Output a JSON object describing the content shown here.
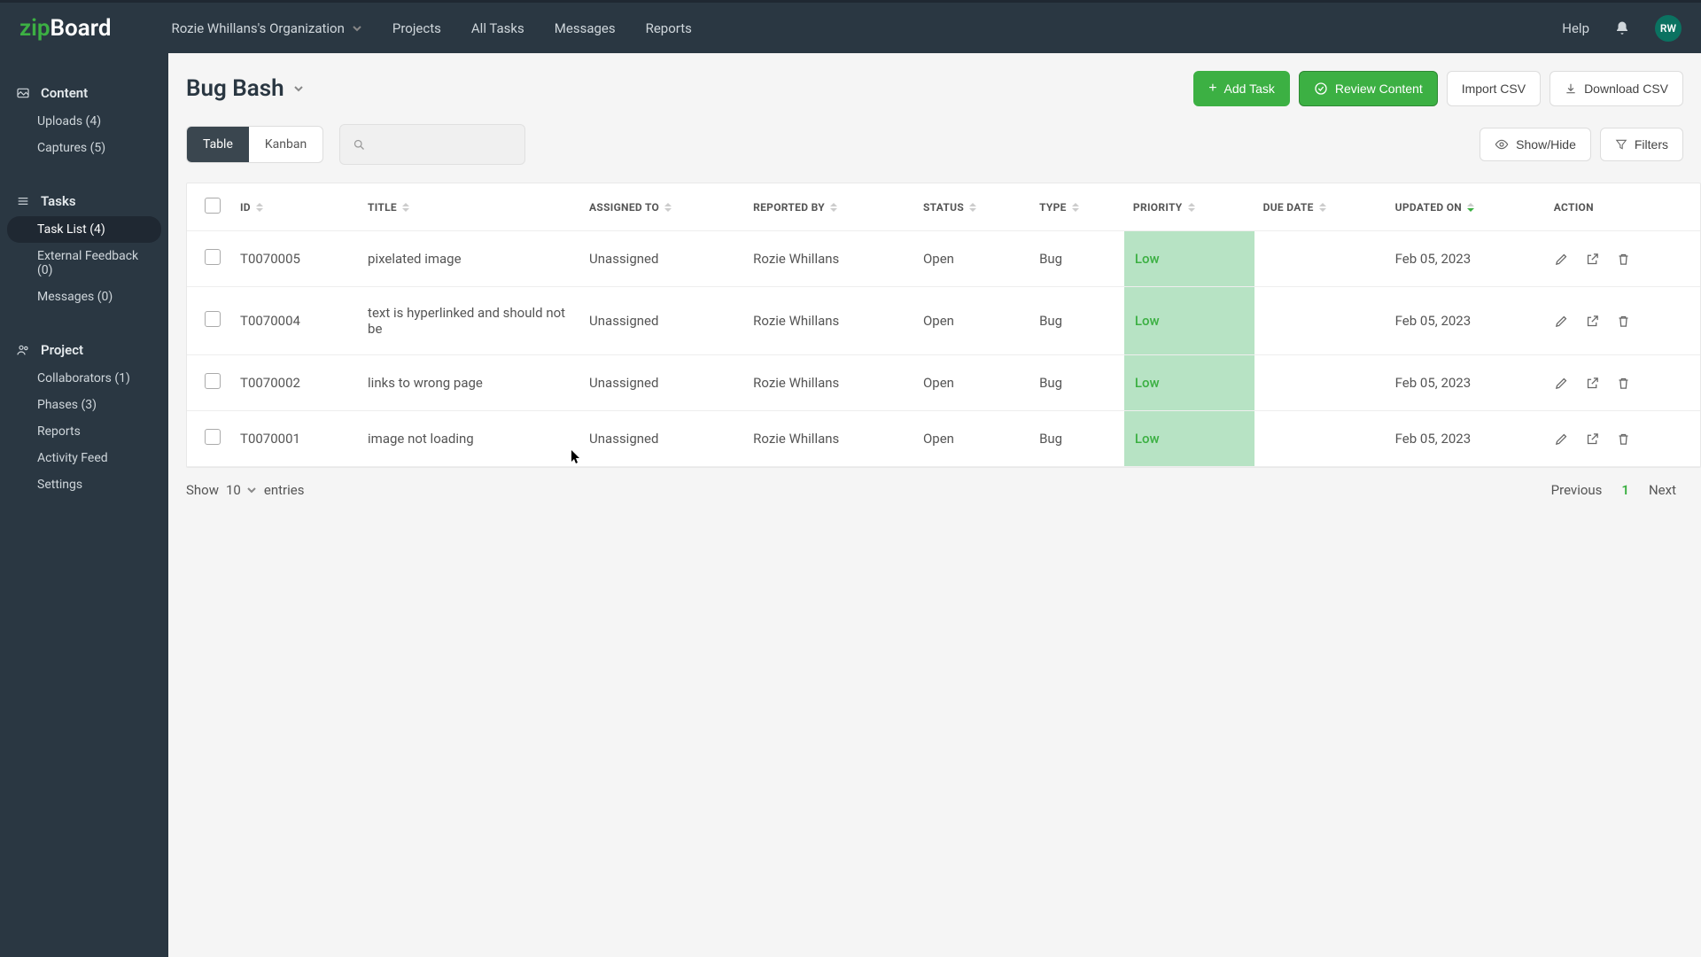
{
  "brand": {
    "zip": "zip",
    "board": "Board"
  },
  "topnav": {
    "org": "Rozie Whillans's Organization",
    "items": [
      "Projects",
      "All Tasks",
      "Messages",
      "Reports"
    ],
    "help": "Help",
    "avatar": "RW"
  },
  "sidebar": {
    "content": {
      "heading": "Content",
      "items": [
        "Uploads (4)",
        "Captures (5)"
      ]
    },
    "tasks": {
      "heading": "Tasks",
      "items": [
        "Task List (4)",
        "External Feedback (0)",
        "Messages (0)"
      ],
      "active_index": 0
    },
    "project": {
      "heading": "Project",
      "items": [
        "Collaborators (1)",
        "Phases (3)",
        "Reports",
        "Activity Feed",
        "Settings"
      ]
    }
  },
  "page": {
    "title": "Bug Bash",
    "buttons": {
      "add": "Add Task",
      "review": "Review Content",
      "import": "Import CSV",
      "download": "Download CSV"
    },
    "views": {
      "table": "Table",
      "kanban": "Kanban"
    },
    "tools": {
      "showhide": "Show/Hide",
      "filters": "Filters"
    }
  },
  "table": {
    "headers": [
      "ID",
      "TITLE",
      "ASSIGNED TO",
      "REPORTED BY",
      "STATUS",
      "TYPE",
      "PRIORITY",
      "DUE DATE",
      "UPDATED ON",
      "ACTION"
    ],
    "rows": [
      {
        "id": "T0070005",
        "title": "pixelated image",
        "assigned": "Unassigned",
        "reported": "Rozie Whillans",
        "status": "Open",
        "type": "Bug",
        "priority": "Low",
        "due": "",
        "updated": "Feb 05, 2023"
      },
      {
        "id": "T0070004",
        "title": "text is hyperlinked and should not be",
        "assigned": "Unassigned",
        "reported": "Rozie Whillans",
        "status": "Open",
        "type": "Bug",
        "priority": "Low",
        "due": "",
        "updated": "Feb 05, 2023"
      },
      {
        "id": "T0070002",
        "title": "links to wrong page",
        "assigned": "Unassigned",
        "reported": "Rozie Whillans",
        "status": "Open",
        "type": "Bug",
        "priority": "Low",
        "due": "",
        "updated": "Feb 05, 2023"
      },
      {
        "id": "T0070001",
        "title": "image not loading",
        "assigned": "Unassigned",
        "reported": "Rozie Whillans",
        "status": "Open",
        "type": "Bug",
        "priority": "Low",
        "due": "",
        "updated": "Feb 05, 2023"
      }
    ]
  },
  "pager": {
    "show": "Show",
    "count": "10",
    "entries": "entries",
    "prev": "Previous",
    "page": "1",
    "next": "Next"
  }
}
